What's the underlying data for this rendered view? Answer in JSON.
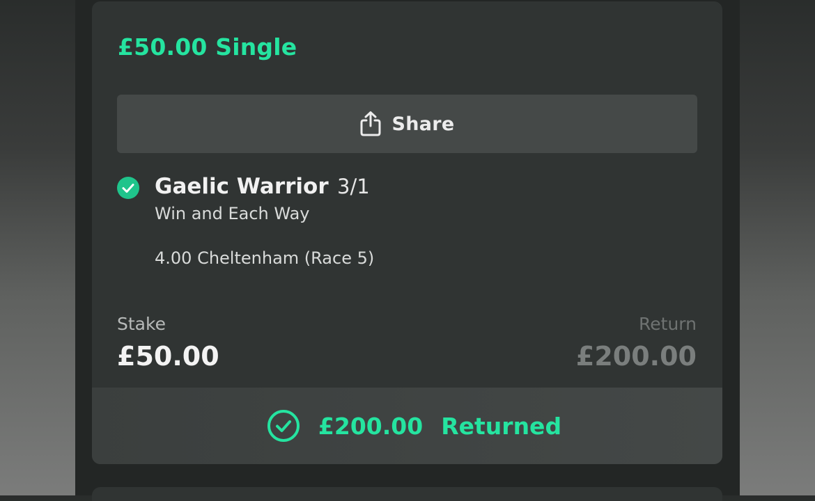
{
  "bet": {
    "title": "£50.00 Single",
    "share_label": "Share",
    "selection": {
      "name": "Gaelic Warrior",
      "odds": "3/1",
      "market": "Win and Each Way",
      "event": "4.00 Cheltenham (Race 5)",
      "status_icon": "check-circle-icon"
    },
    "stake_label": "Stake",
    "stake_value": "£50.00",
    "return_label": "Return",
    "return_value": "£200.00",
    "returned": {
      "amount": "£200.00",
      "label": "Returned",
      "icon": "check-circle-outline-icon"
    }
  },
  "colors": {
    "accent": "#25e4a0",
    "card_background": "#303433",
    "share_button_background": "#454948",
    "page_frame": "#232625"
  }
}
